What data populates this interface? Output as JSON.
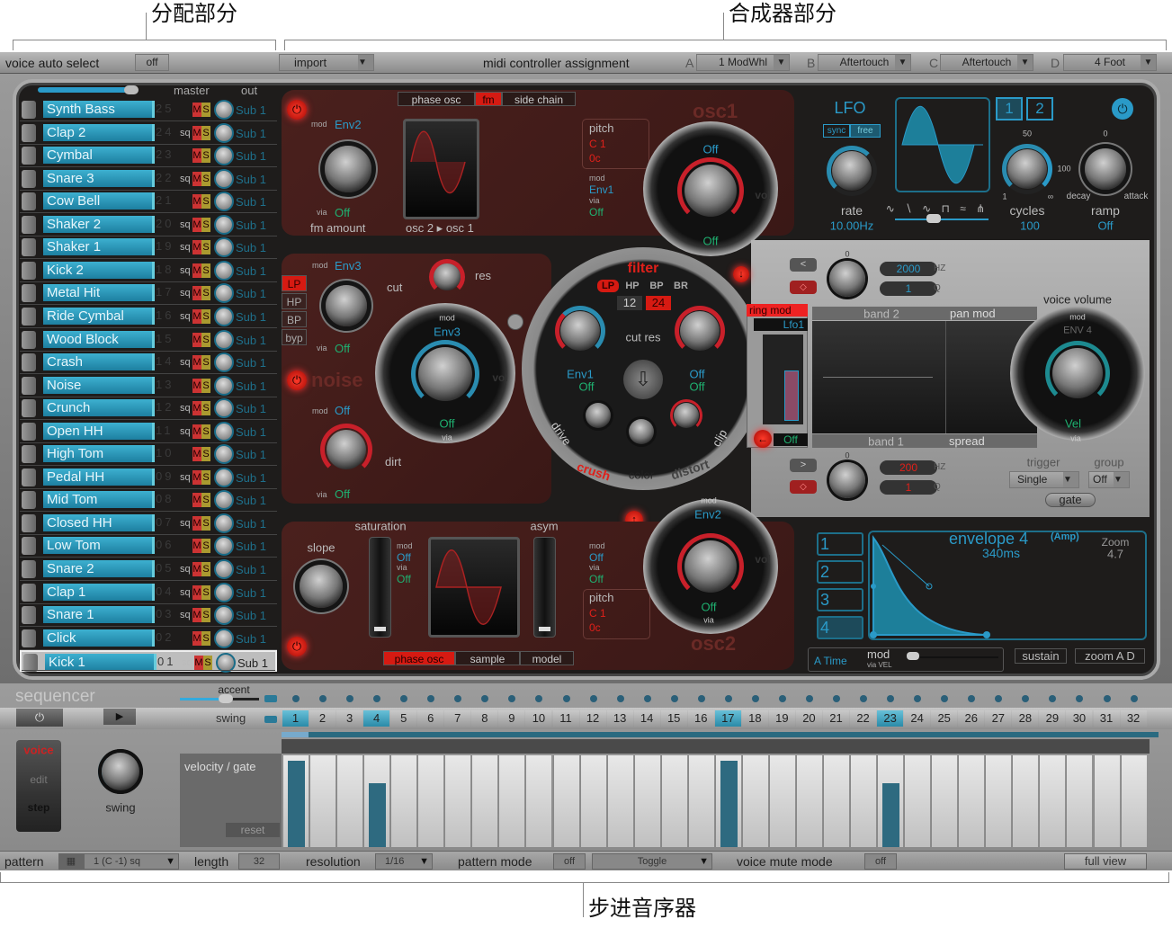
{
  "annotations": {
    "assign": "分配部分",
    "synth": "合成器部分",
    "sequencer": "步进音序器"
  },
  "topbar": {
    "voice_auto_select": "voice auto select",
    "voice_auto_select_value": "off",
    "import": "import",
    "midi_label": "midi controller assignment",
    "slots": [
      {
        "letter": "A",
        "value": "1 ModWhl"
      },
      {
        "letter": "B",
        "value": "Aftertouch"
      },
      {
        "letter": "C",
        "value": "Aftertouch"
      },
      {
        "letter": "D",
        "value": "4 Foot"
      }
    ]
  },
  "voices": {
    "master": "master",
    "out": "out",
    "master_volume": 0.75,
    "mute": "M",
    "solo": "S",
    "sq": "sq",
    "rows": [
      {
        "name": "Synth Bass",
        "num": "25",
        "sq": false,
        "out": "Sub 1"
      },
      {
        "name": "Clap 2",
        "num": "24",
        "sq": true,
        "out": "Sub 1"
      },
      {
        "name": "Cymbal",
        "num": "23",
        "sq": false,
        "out": "Sub 1"
      },
      {
        "name": "Snare 3",
        "num": "22",
        "sq": true,
        "out": "Sub 1"
      },
      {
        "name": "Cow Bell",
        "num": "21",
        "sq": false,
        "out": "Sub 1"
      },
      {
        "name": "Shaker 2",
        "num": "20",
        "sq": true,
        "out": "Sub 1"
      },
      {
        "name": "Shaker 1",
        "num": "19",
        "sq": true,
        "out": "Sub 1"
      },
      {
        "name": "Kick 2",
        "num": "18",
        "sq": true,
        "out": "Sub 1"
      },
      {
        "name": "Metal Hit",
        "num": "17",
        "sq": true,
        "out": "Sub 1"
      },
      {
        "name": "Ride Cymbal",
        "num": "16",
        "sq": true,
        "out": "Sub 1"
      },
      {
        "name": "Wood Block",
        "num": "15",
        "sq": false,
        "out": "Sub 1"
      },
      {
        "name": "Crash",
        "num": "14",
        "sq": true,
        "out": "Sub 1"
      },
      {
        "name": "Noise",
        "num": "13",
        "sq": false,
        "out": "Sub 1"
      },
      {
        "name": "Crunch",
        "num": "12",
        "sq": true,
        "out": "Sub 1"
      },
      {
        "name": "Open HH",
        "num": "11",
        "sq": true,
        "out": "Sub 1"
      },
      {
        "name": "High Tom",
        "num": "10",
        "sq": false,
        "out": "Sub 1"
      },
      {
        "name": "Pedal HH",
        "num": "09",
        "sq": true,
        "out": "Sub 1"
      },
      {
        "name": "Mid Tom",
        "num": "08",
        "sq": false,
        "out": "Sub 1"
      },
      {
        "name": "Closed HH",
        "num": "07",
        "sq": true,
        "out": "Sub 1"
      },
      {
        "name": "Low Tom",
        "num": "06",
        "sq": false,
        "out": "Sub 1"
      },
      {
        "name": "Snare 2",
        "num": "05",
        "sq": true,
        "out": "Sub 1"
      },
      {
        "name": "Clap 1",
        "num": "04",
        "sq": true,
        "out": "Sub 1"
      },
      {
        "name": "Snare 1",
        "num": "03",
        "sq": true,
        "out": "Sub 1"
      },
      {
        "name": "Click",
        "num": "02",
        "sq": false,
        "out": "Sub 1"
      },
      {
        "name": "Kick 1",
        "num": "01",
        "sq": true,
        "out": "Sub 1",
        "selected": true
      }
    ]
  },
  "osc1": {
    "title": "osc1",
    "tabs": [
      "phase osc",
      "fm",
      "side chain"
    ],
    "active_tab": "fm",
    "mod_label": "mod",
    "via_label": "via",
    "fm_mod": "Env2",
    "fm_via": "Off",
    "fm_amount": "fm amount",
    "route": "osc 2 ▸ osc 1",
    "pitch_label": "pitch",
    "pitch_note": "C 1",
    "pitch_cent": "0c",
    "pitch_mod": "Env1",
    "pitch_via": "Off",
    "vol_mod": "Off",
    "vol_via": "Off",
    "vol_label": "vol"
  },
  "noise": {
    "title": "noise",
    "filter_types": [
      "LP",
      "HP",
      "BP",
      "byp"
    ],
    "active_filter": "LP",
    "cut_mod": "Env3",
    "cut_via": "Off",
    "cut": "cut",
    "res": "res",
    "vol_mod": "Env3",
    "vol_via": "Off",
    "vol_label": "vol",
    "dirt_mod": "Off",
    "dirt_via": "Off",
    "dirt": "dirt"
  },
  "filter": {
    "title": "filter",
    "types": [
      "LP",
      "HP",
      "BP",
      "BR"
    ],
    "active_type": "LP",
    "slopes": [
      "12",
      "24"
    ],
    "active_slope": "24",
    "cut_res": "cut  res",
    "cut_mod": "Env1",
    "cut_via": "Off",
    "res_mod": "Off",
    "res_via": "Off",
    "drive": "drive",
    "clip": "clip",
    "crush": "crush",
    "color": "color",
    "distort": "distort"
  },
  "ringmod": {
    "label": "ring mod",
    "mod": "Lfo1",
    "via": "Off"
  },
  "eq": {
    "band2": "band 2",
    "band1": "band 1",
    "pan_mod": "pan mod",
    "spread": "spread",
    "band2_freq": "2000",
    "band2_q": "1",
    "band1_freq": "200",
    "band1_q": "1",
    "hz": "HZ",
    "q": "Q",
    "zero": "0"
  },
  "voice_volume": {
    "label": "voice volume",
    "mod": "ENV 4",
    "via": "Vel",
    "trigger_label": "trigger",
    "trigger": "Single",
    "group_label": "group",
    "group": "Off",
    "gate": "gate"
  },
  "lfo": {
    "title": "LFO",
    "sync": "sync",
    "free": "free",
    "rate_label": "rate",
    "rate": "10.00Hz",
    "tabs": [
      "1",
      "2"
    ],
    "cycles_label": "cycles",
    "cycles": "100",
    "cycles_ticks": [
      "50",
      "100",
      "1",
      "∞"
    ],
    "ramp_label": "ramp",
    "ramp": "Off",
    "ramp_ticks": [
      "0",
      "decay",
      "attack"
    ],
    "shapes": "∿ ∖ ∿ ⊓ ≈ ⋔"
  },
  "osc2": {
    "title": "osc2",
    "tabs": [
      "phase osc",
      "sample",
      "model"
    ],
    "active_tab": "phase osc",
    "saturation": "saturation",
    "asym": "asym",
    "slope": "slope",
    "sat_mod": "Off",
    "sat_via": "Off",
    "asym_mod": "Off",
    "asym_via": "Off",
    "pitch_label": "pitch",
    "pitch_note": "C 1",
    "pitch_cent": "0c",
    "vol_mod": "Env2",
    "vol_via": "Off",
    "vol_label": "vol"
  },
  "envelope": {
    "title": "envelope 4",
    "subtitle": "(Amp)",
    "time": "340ms",
    "zoom_label": "Zoom",
    "zoom": "4.7",
    "buttons": [
      "1",
      "2",
      "3",
      "4"
    ],
    "active": "4",
    "a_time": "A Time",
    "mod": "mod",
    "via": "via VEL",
    "sustain": "sustain",
    "zoom_ad": "zoom A D"
  },
  "sequencer": {
    "title": "sequencer",
    "accent": "accent",
    "swing": "swing",
    "mode": [
      "voice",
      "edit",
      "step"
    ],
    "swing_knob": "swing",
    "velocity_gate": "velocity / gate",
    "reset": "reset",
    "steps": [
      "1",
      "2",
      "3",
      "4",
      "5",
      "6",
      "7",
      "8",
      "9",
      "10",
      "11",
      "12",
      "13",
      "14",
      "15",
      "16",
      "17",
      "18",
      "19",
      "20",
      "21",
      "22",
      "23",
      "24",
      "25",
      "26",
      "27",
      "28",
      "29",
      "30",
      "31",
      "32"
    ],
    "active_steps": [
      1,
      4,
      17,
      23
    ],
    "velocities": {
      "1": 1.0,
      "4": 0.74,
      "17": 1.0,
      "23": 0.74
    }
  },
  "bottombar": {
    "pattern": "pattern",
    "pattern_value": "1 (C -1) sq",
    "length": "length",
    "length_value": "32",
    "resolution": "resolution",
    "resolution_value": "1/16",
    "pattern_mode": "pattern mode",
    "pattern_mode_value": "off",
    "toggle": "Toggle",
    "voice_mute_mode": "voice mute mode",
    "voice_mute_mode_value": "off",
    "full_view": "full view"
  },
  "colors": {
    "accent_blue": "#2a9ac8",
    "accent_red": "#d61a12",
    "via_green": "#1fb070"
  }
}
